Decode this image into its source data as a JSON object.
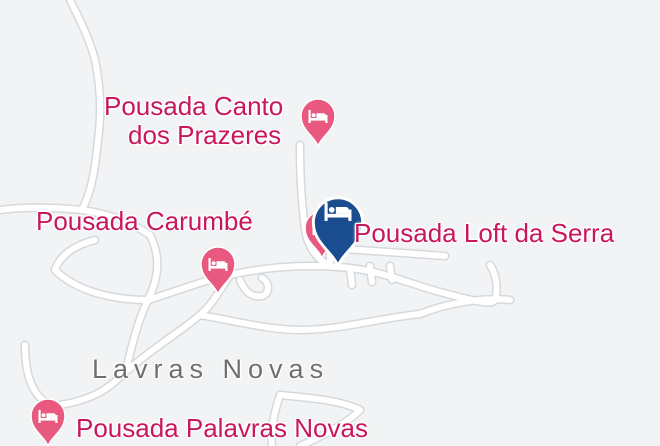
{
  "map": {
    "town_label": "Lavras Novas",
    "colors": {
      "background": "#f1f3f4",
      "road": "#ffffff",
      "road_casing": "#d6d9dc",
      "hotel_marker": "#e8587f",
      "hotel_label": "#c8175a",
      "selected_marker": "#1a4d8f",
      "town_label": "#6f6f6f"
    },
    "markers": [
      {
        "name": "Pousada Canto dos Prazeres",
        "label_lines": [
          "Pousada Canto",
          "dos Prazeres"
        ],
        "icon": "bed-icon",
        "selected": false
      },
      {
        "name": "Pousada Carumbé",
        "label_lines": [
          "Pousada Carumbé"
        ],
        "icon": "bed-icon",
        "selected": false
      },
      {
        "name": "Pousada Loft da Serra",
        "label_lines": [
          "Pousada Loft da Serra"
        ],
        "icon": "bed-icon",
        "selected": true
      },
      {
        "name": "Pousada Palavras Novas",
        "label_lines": [
          "Pousada Palavras Novas"
        ],
        "icon": "bed-icon",
        "selected": false
      }
    ]
  }
}
